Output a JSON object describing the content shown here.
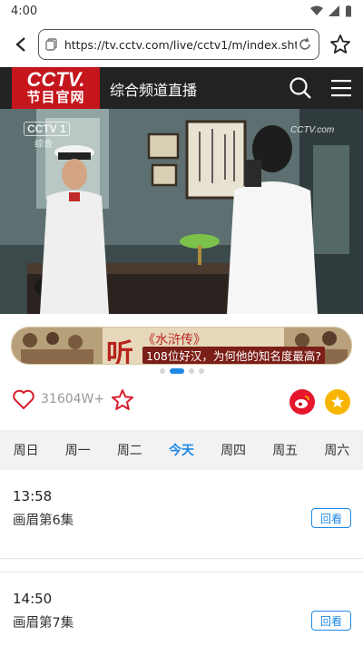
{
  "status_bar": {
    "time": "4:00"
  },
  "browser": {
    "url": "https://tv.cctv.com/live/cctv1/m/index.shtml"
  },
  "header": {
    "logo_line1": "CCTV.",
    "logo_line2": "节目官网",
    "channel_title": "综合频道直播"
  },
  "video": {
    "channel_logo": "CCTV 1",
    "channel_sub": "综合",
    "corner_logo": "CCTV.com"
  },
  "banner": {
    "char": "听",
    "title": "《水浒传》",
    "subtitle": "108位好汉，为何他的知名度最高?"
  },
  "carousel": {
    "count": 4,
    "active": 1
  },
  "actions": {
    "like_count": "31604W+"
  },
  "day_tabs": [
    "周日",
    "周一",
    "周二",
    "今天",
    "周四",
    "周五",
    "周六"
  ],
  "active_day_index": 3,
  "programs": [
    {
      "time": "13:58",
      "title": "画眉第6集",
      "action": "回看"
    },
    {
      "time": "14:50",
      "title": "画眉第7集",
      "action": "回看"
    }
  ],
  "colors": {
    "brand_red": "#c4161c",
    "accent_blue": "#1e88e5",
    "header_bg": "#222222"
  }
}
